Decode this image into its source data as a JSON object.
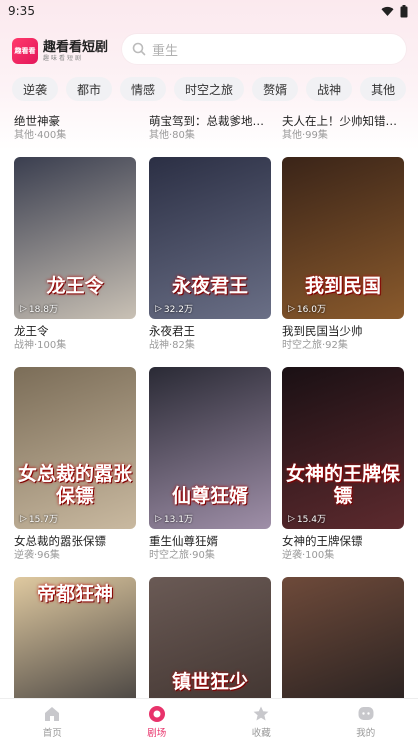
{
  "status": {
    "time": "9:35"
  },
  "header": {
    "logo_text": "趣看看",
    "brand_name": "趣看看短剧",
    "brand_sub": "趣味看短剧",
    "search_placeholder": "重生"
  },
  "tabs": [
    "逆袭",
    "都市",
    "情感",
    "时空之旅",
    "赘婿",
    "战神",
    "其他"
  ],
  "partial_row": [
    {
      "title": "绝世神豪",
      "sub": "其他·400集"
    },
    {
      "title": "萌宝驾到：总裁爹地快...",
      "sub": "其他·80集"
    },
    {
      "title": "夫人在上！少帅知错了！",
      "sub": "其他·99集"
    }
  ],
  "cards": [
    {
      "title": "龙王令",
      "sub": "战神·100集",
      "plays": "18.8万",
      "poster_text": "龙王令",
      "bg1": "#3a3e4f",
      "bg2": "#c9c1b5"
    },
    {
      "title": "永夜君王",
      "sub": "战神·82集",
      "plays": "32.2万",
      "poster_text": "永夜君王",
      "bg1": "#2b2f44",
      "bg2": "#6a6f86"
    },
    {
      "title": "我到民国当少帅",
      "sub": "时空之旅·92集",
      "plays": "16.0万",
      "poster_text": "我到民国",
      "bg1": "#3a2418",
      "bg2": "#8a5a2c"
    },
    {
      "title": "女总裁的嚣张保镖",
      "sub": "逆袭·96集",
      "plays": "15.7万",
      "poster_text": "女总裁的嚣张保镖",
      "bg1": "#7b6d58",
      "bg2": "#c9b9a0"
    },
    {
      "title": "重生仙尊狂婿",
      "sub": "时空之旅·90集",
      "plays": "13.1万",
      "poster_text": "仙尊狂婿",
      "bg1": "#2a2a35",
      "bg2": "#9f8fa8"
    },
    {
      "title": "女神的王牌保镖",
      "sub": "逆袭·100集",
      "plays": "15.4万",
      "poster_text": "女神的王牌保镖",
      "bg1": "#1a1014",
      "bg2": "#5d2a2e"
    },
    {
      "title": "",
      "sub": "",
      "plays": "",
      "poster_text": "帝都狂神",
      "bg1": "#dfc9a0",
      "bg2": "#2b2a2f"
    },
    {
      "title": "",
      "sub": "",
      "plays": "",
      "poster_text": "镇世狂少",
      "bg1": "#6a5a55",
      "bg2": "#3a2e2a"
    },
    {
      "title": "",
      "sub": "",
      "plays": "",
      "poster_text": "",
      "bg1": "#6e4a3a",
      "bg2": "#1c1a1c"
    }
  ],
  "bottom_nav": [
    {
      "label": "首页",
      "active": false
    },
    {
      "label": "剧场",
      "active": true
    },
    {
      "label": "收藏",
      "active": false
    },
    {
      "label": "我的",
      "active": false
    }
  ],
  "colors": {
    "accent": "#e8336b",
    "logo": "#ff3b6b"
  }
}
